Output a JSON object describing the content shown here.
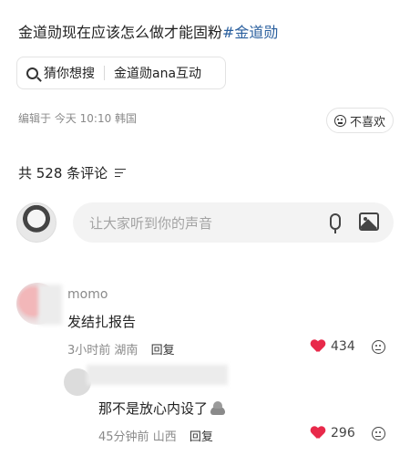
{
  "post": {
    "title": "金道勋现在应该怎么做才能固粉",
    "hashtag": "#金道勋",
    "search_prefix": "猜你想搜",
    "search_suggestion": "金道勋ana互动",
    "edited_meta": "编辑于  今天 10:10  韩国",
    "dislike_label": "不喜欢"
  },
  "comments_header": {
    "count_label": "共 528 条评论"
  },
  "composer": {
    "placeholder": "让大家听到你的声音"
  },
  "comments": [
    {
      "username": "momo",
      "text": "发结扎报告",
      "time": "3小时前",
      "location": "湖南",
      "reply_label": "回复",
      "likes": "434"
    },
    {
      "username": "",
      "text": "那不是放心内设了",
      "time": "45分钟前",
      "location": "山西",
      "reply_label": "回复",
      "likes": "296"
    }
  ],
  "colors": {
    "hashtag": "#2a5f9e",
    "heart": "#e8294a",
    "muted": "#8a8a8a"
  },
  "icons": [
    "search-icon",
    "dislike-face-icon",
    "filter-icon",
    "microphone-icon",
    "image-icon",
    "heart-icon",
    "emoji-icon",
    "poop-emoji-icon"
  ]
}
